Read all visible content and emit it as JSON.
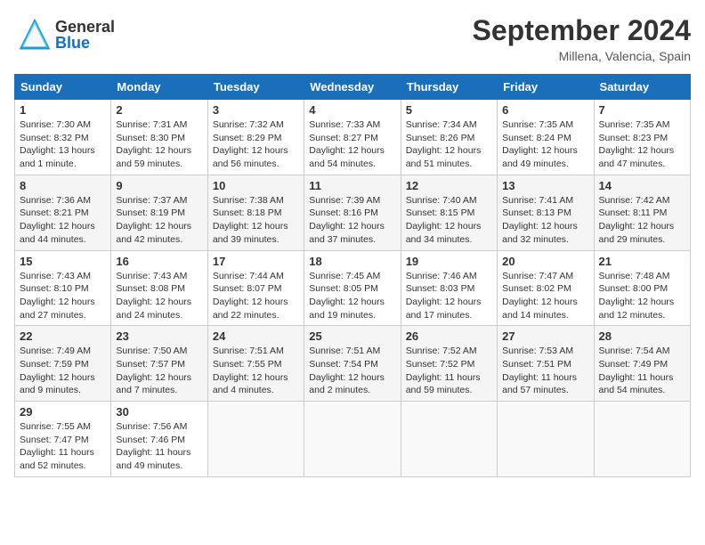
{
  "header": {
    "logo_general": "General",
    "logo_blue": "Blue",
    "month": "September 2024",
    "location": "Millena, Valencia, Spain"
  },
  "days_of_week": [
    "Sunday",
    "Monday",
    "Tuesday",
    "Wednesday",
    "Thursday",
    "Friday",
    "Saturday"
  ],
  "weeks": [
    [
      {
        "day": "1",
        "info": "Sunrise: 7:30 AM\nSunset: 8:32 PM\nDaylight: 13 hours\nand 1 minute."
      },
      {
        "day": "2",
        "info": "Sunrise: 7:31 AM\nSunset: 8:30 PM\nDaylight: 12 hours\nand 59 minutes."
      },
      {
        "day": "3",
        "info": "Sunrise: 7:32 AM\nSunset: 8:29 PM\nDaylight: 12 hours\nand 56 minutes."
      },
      {
        "day": "4",
        "info": "Sunrise: 7:33 AM\nSunset: 8:27 PM\nDaylight: 12 hours\nand 54 minutes."
      },
      {
        "day": "5",
        "info": "Sunrise: 7:34 AM\nSunset: 8:26 PM\nDaylight: 12 hours\nand 51 minutes."
      },
      {
        "day": "6",
        "info": "Sunrise: 7:35 AM\nSunset: 8:24 PM\nDaylight: 12 hours\nand 49 minutes."
      },
      {
        "day": "7",
        "info": "Sunrise: 7:35 AM\nSunset: 8:23 PM\nDaylight: 12 hours\nand 47 minutes."
      }
    ],
    [
      {
        "day": "8",
        "info": "Sunrise: 7:36 AM\nSunset: 8:21 PM\nDaylight: 12 hours\nand 44 minutes."
      },
      {
        "day": "9",
        "info": "Sunrise: 7:37 AM\nSunset: 8:19 PM\nDaylight: 12 hours\nand 42 minutes."
      },
      {
        "day": "10",
        "info": "Sunrise: 7:38 AM\nSunset: 8:18 PM\nDaylight: 12 hours\nand 39 minutes."
      },
      {
        "day": "11",
        "info": "Sunrise: 7:39 AM\nSunset: 8:16 PM\nDaylight: 12 hours\nand 37 minutes."
      },
      {
        "day": "12",
        "info": "Sunrise: 7:40 AM\nSunset: 8:15 PM\nDaylight: 12 hours\nand 34 minutes."
      },
      {
        "day": "13",
        "info": "Sunrise: 7:41 AM\nSunset: 8:13 PM\nDaylight: 12 hours\nand 32 minutes."
      },
      {
        "day": "14",
        "info": "Sunrise: 7:42 AM\nSunset: 8:11 PM\nDaylight: 12 hours\nand 29 minutes."
      }
    ],
    [
      {
        "day": "15",
        "info": "Sunrise: 7:43 AM\nSunset: 8:10 PM\nDaylight: 12 hours\nand 27 minutes."
      },
      {
        "day": "16",
        "info": "Sunrise: 7:43 AM\nSunset: 8:08 PM\nDaylight: 12 hours\nand 24 minutes."
      },
      {
        "day": "17",
        "info": "Sunrise: 7:44 AM\nSunset: 8:07 PM\nDaylight: 12 hours\nand 22 minutes."
      },
      {
        "day": "18",
        "info": "Sunrise: 7:45 AM\nSunset: 8:05 PM\nDaylight: 12 hours\nand 19 minutes."
      },
      {
        "day": "19",
        "info": "Sunrise: 7:46 AM\nSunset: 8:03 PM\nDaylight: 12 hours\nand 17 minutes."
      },
      {
        "day": "20",
        "info": "Sunrise: 7:47 AM\nSunset: 8:02 PM\nDaylight: 12 hours\nand 14 minutes."
      },
      {
        "day": "21",
        "info": "Sunrise: 7:48 AM\nSunset: 8:00 PM\nDaylight: 12 hours\nand 12 minutes."
      }
    ],
    [
      {
        "day": "22",
        "info": "Sunrise: 7:49 AM\nSunset: 7:59 PM\nDaylight: 12 hours\nand 9 minutes."
      },
      {
        "day": "23",
        "info": "Sunrise: 7:50 AM\nSunset: 7:57 PM\nDaylight: 12 hours\nand 7 minutes."
      },
      {
        "day": "24",
        "info": "Sunrise: 7:51 AM\nSunset: 7:55 PM\nDaylight: 12 hours\nand 4 minutes."
      },
      {
        "day": "25",
        "info": "Sunrise: 7:51 AM\nSunset: 7:54 PM\nDaylight: 12 hours\nand 2 minutes."
      },
      {
        "day": "26",
        "info": "Sunrise: 7:52 AM\nSunset: 7:52 PM\nDaylight: 11 hours\nand 59 minutes."
      },
      {
        "day": "27",
        "info": "Sunrise: 7:53 AM\nSunset: 7:51 PM\nDaylight: 11 hours\nand 57 minutes."
      },
      {
        "day": "28",
        "info": "Sunrise: 7:54 AM\nSunset: 7:49 PM\nDaylight: 11 hours\nand 54 minutes."
      }
    ],
    [
      {
        "day": "29",
        "info": "Sunrise: 7:55 AM\nSunset: 7:47 PM\nDaylight: 11 hours\nand 52 minutes."
      },
      {
        "day": "30",
        "info": "Sunrise: 7:56 AM\nSunset: 7:46 PM\nDaylight: 11 hours\nand 49 minutes."
      },
      {
        "day": "",
        "info": ""
      },
      {
        "day": "",
        "info": ""
      },
      {
        "day": "",
        "info": ""
      },
      {
        "day": "",
        "info": ""
      },
      {
        "day": "",
        "info": ""
      }
    ]
  ]
}
